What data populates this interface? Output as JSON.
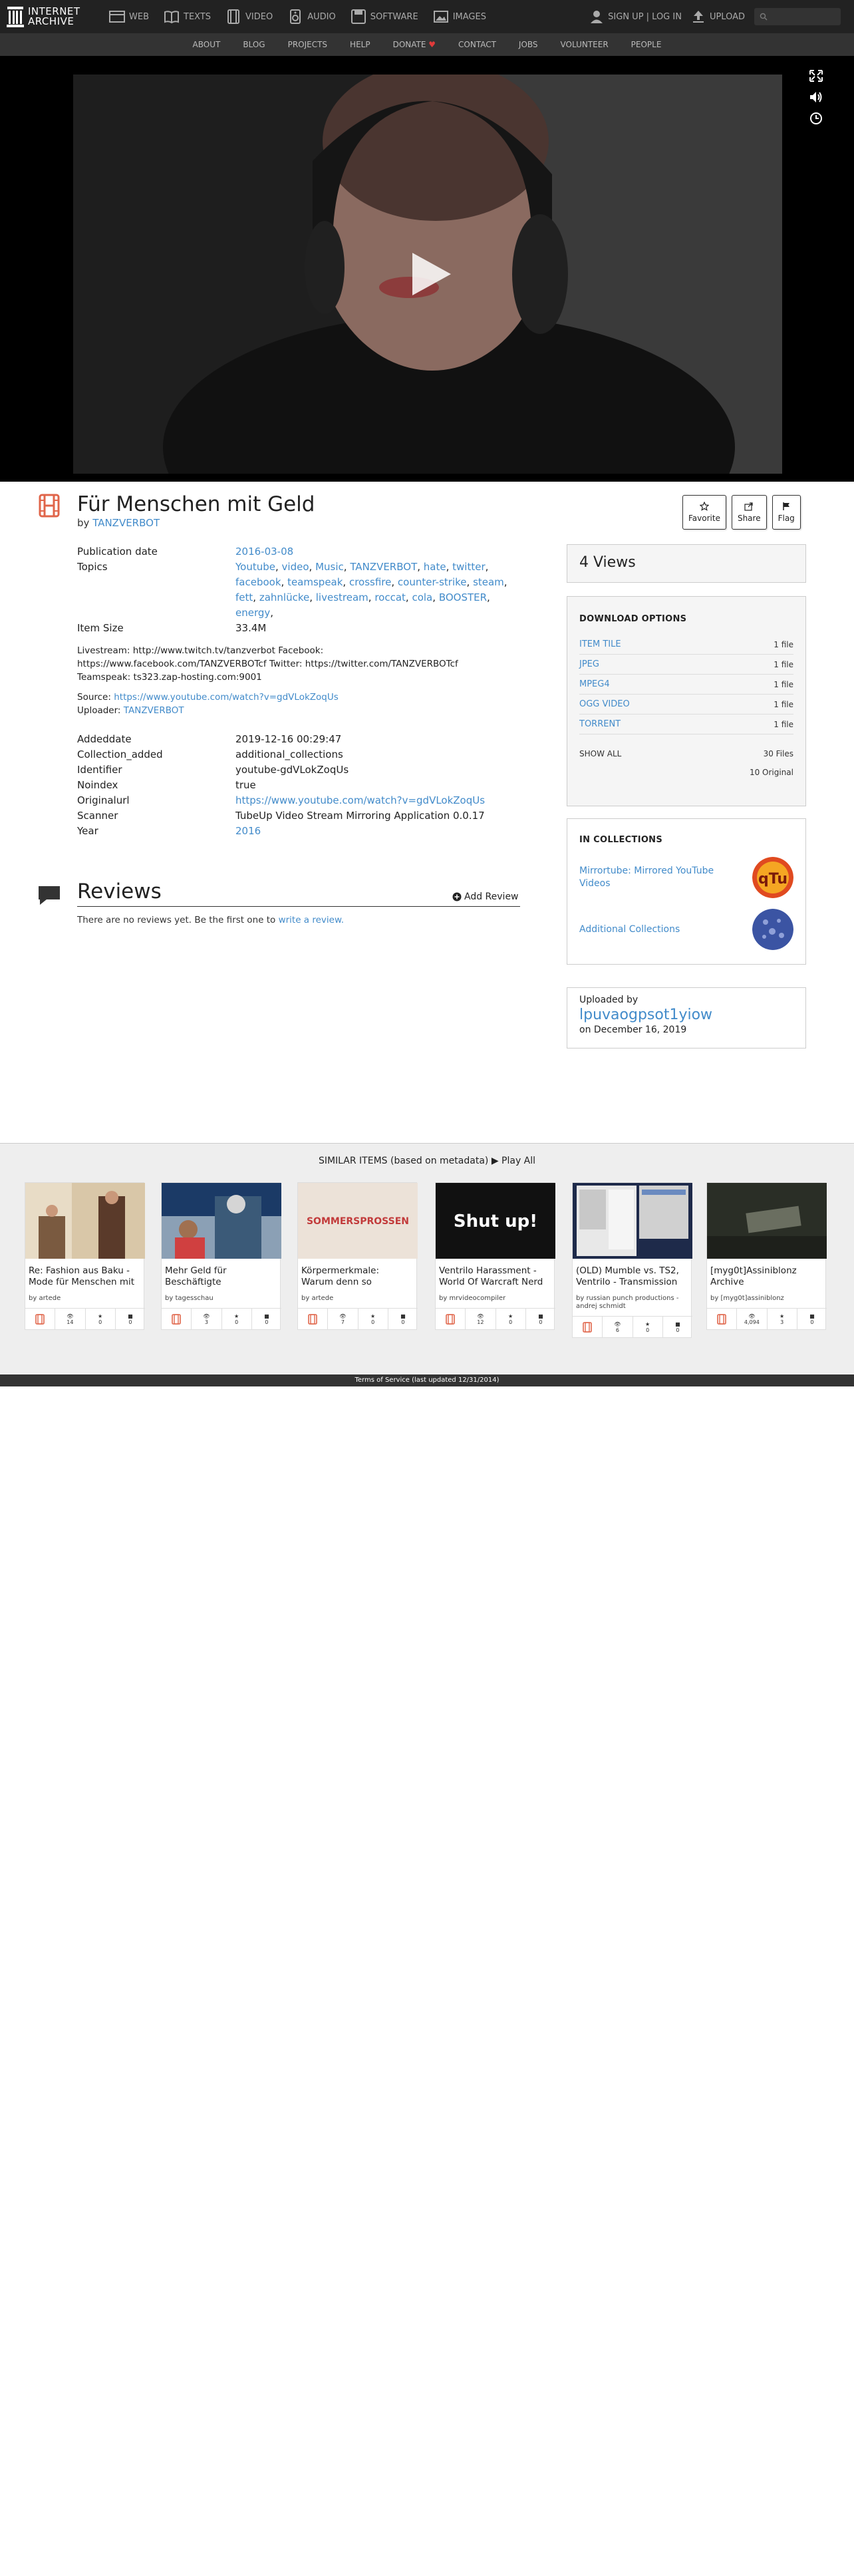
{
  "nav": {
    "logo_line1": "INTERNET",
    "logo_line2": "ARCHIVE",
    "items": [
      {
        "label": "WEB",
        "icon": "web-icon"
      },
      {
        "label": "TEXTS",
        "icon": "book-icon"
      },
      {
        "label": "VIDEO",
        "icon": "film-icon"
      },
      {
        "label": "AUDIO",
        "icon": "speaker-icon"
      },
      {
        "label": "SOFTWARE",
        "icon": "floppy-icon"
      },
      {
        "label": "IMAGES",
        "icon": "image-icon"
      }
    ],
    "signup": "SIGN UP | LOG IN",
    "upload": "UPLOAD"
  },
  "subnav": [
    "ABOUT",
    "BLOG",
    "PROJECTS",
    "HELP",
    "DONATE",
    "CONTACT",
    "JOBS",
    "VOLUNTEER",
    "PEOPLE"
  ],
  "item": {
    "title": "Für Menschen mit Geld",
    "by_prefix": "by",
    "by": "TANZVERBOT",
    "actions": {
      "favorite": "Favorite",
      "share": "Share",
      "flag": "Flag"
    }
  },
  "metadata": {
    "pubdate_label": "Publication date",
    "pubdate": "2016-03-08",
    "topics_label": "Topics",
    "topics": [
      "Youtube",
      "video",
      "Music",
      "TANZVERBOT",
      "hate",
      "twitter",
      "facebook",
      "teamspeak",
      "crossfire",
      "counter-strike",
      "steam",
      "fett",
      "zahnlücke",
      "livestream",
      "roccat",
      "cola",
      "BOOSTER",
      "energy"
    ],
    "size_label": "Item Size",
    "size": "33.4M",
    "description_1": "Livestream: http://www.twitch.tv/tanzverbot Facebook:",
    "description_2": "https://www.facebook.com/TANZVERBOTcf Twitter: https://twitter.com/TANZVERBOTcf",
    "description_3": "Teamspeak: ts323.zap-hosting.com:9001",
    "source_label": "Source:",
    "source": "https://www.youtube.com/watch?v=gdVLokZoqUs",
    "uploader_label": "Uploader:",
    "uploader": "TANZVERBOT",
    "fields": [
      {
        "label": "Addeddate",
        "value": "2019-12-16 00:29:47",
        "link": false
      },
      {
        "label": "Collection_added",
        "value": "additional_collections",
        "link": false
      },
      {
        "label": "Identifier",
        "value": "youtube-gdVLokZoqUs",
        "link": false
      },
      {
        "label": "Noindex",
        "value": "true",
        "link": false
      },
      {
        "label": "Originalurl",
        "value": "https://www.youtube.com/watch?v=gdVLokZoqUs",
        "link": true
      },
      {
        "label": "Scanner",
        "value": "TubeUp Video Stream Mirroring Application 0.0.17",
        "link": false
      },
      {
        "label": "Year",
        "value": "2016",
        "link": true
      }
    ]
  },
  "reviews": {
    "title": "Reviews",
    "add": "Add Review",
    "empty_prefix": "There are no reviews yet. Be the first one to",
    "empty_link": "write a review."
  },
  "sidebar": {
    "views": "4 Views",
    "download_title": "DOWNLOAD OPTIONS",
    "downloads": [
      {
        "label": "ITEM TILE",
        "count": "1 file"
      },
      {
        "label": "JPEG",
        "count": "1 file"
      },
      {
        "label": "MPEG4",
        "count": "1 file"
      },
      {
        "label": "OGG VIDEO",
        "count": "1 file"
      },
      {
        "label": "TORRENT",
        "count": "1 file"
      }
    ],
    "show_all": "SHOW ALL",
    "files": "30 Files",
    "original": "10 Original",
    "collections_title": "IN COLLECTIONS",
    "collections": [
      {
        "label": "Mirrortube: Mirrored YouTube Videos",
        "thumb_text": "qTu"
      },
      {
        "label": "Additional Collections",
        "thumb_text": ""
      }
    ],
    "uploaded_by_label": "Uploaded by",
    "uploader_name": "lpuvaogpsot1yiow",
    "uploaded_on": "on December 16, 2019"
  },
  "similar": {
    "title": "SIMILAR ITEMS (based on metadata)",
    "play_all": "Play All",
    "items": [
      {
        "title": "Re: Fashion aus Baku - Mode für Menschen mit",
        "by": "by artede",
        "views": "14",
        "favs": "0",
        "reviews": "0",
        "thumb": "room"
      },
      {
        "title": "Mehr Geld für Beschäftigte",
        "by": "by tagesschau",
        "views": "3",
        "favs": "0",
        "reviews": "0",
        "thumb": "news"
      },
      {
        "title": "Körpermerkmale: Warum denn so",
        "by": "by artede",
        "views": "7",
        "favs": "0",
        "reviews": "0",
        "thumb": "freckles",
        "thumb_text": "SOMMERSPROSSEN"
      },
      {
        "title": "Ventrilo Harassment - World Of Warcraft Nerd",
        "by": "by mrvideocompiler",
        "views": "12",
        "favs": "0",
        "reviews": "0",
        "thumb": "shutup",
        "thumb_text": "Shut up!"
      },
      {
        "title": "(OLD) Mumble vs. TS2, Ventrilo - Transmission",
        "by": "by russian punch productions - andrej schmidt",
        "views": "6",
        "favs": "0",
        "reviews": "0",
        "thumb": "screen"
      },
      {
        "title": "[myg0t]Assiniblonz Archive",
        "by": "by [myg0t]assiniblonz",
        "views": "4,094",
        "favs": "3",
        "reviews": "0",
        "thumb": "dark"
      }
    ]
  },
  "footer": "Terms of Service (last updated 12/31/2014)",
  "colors": {
    "link": "#428bca",
    "accent_icon": "#e0654a",
    "nav_bg": "#222222"
  }
}
